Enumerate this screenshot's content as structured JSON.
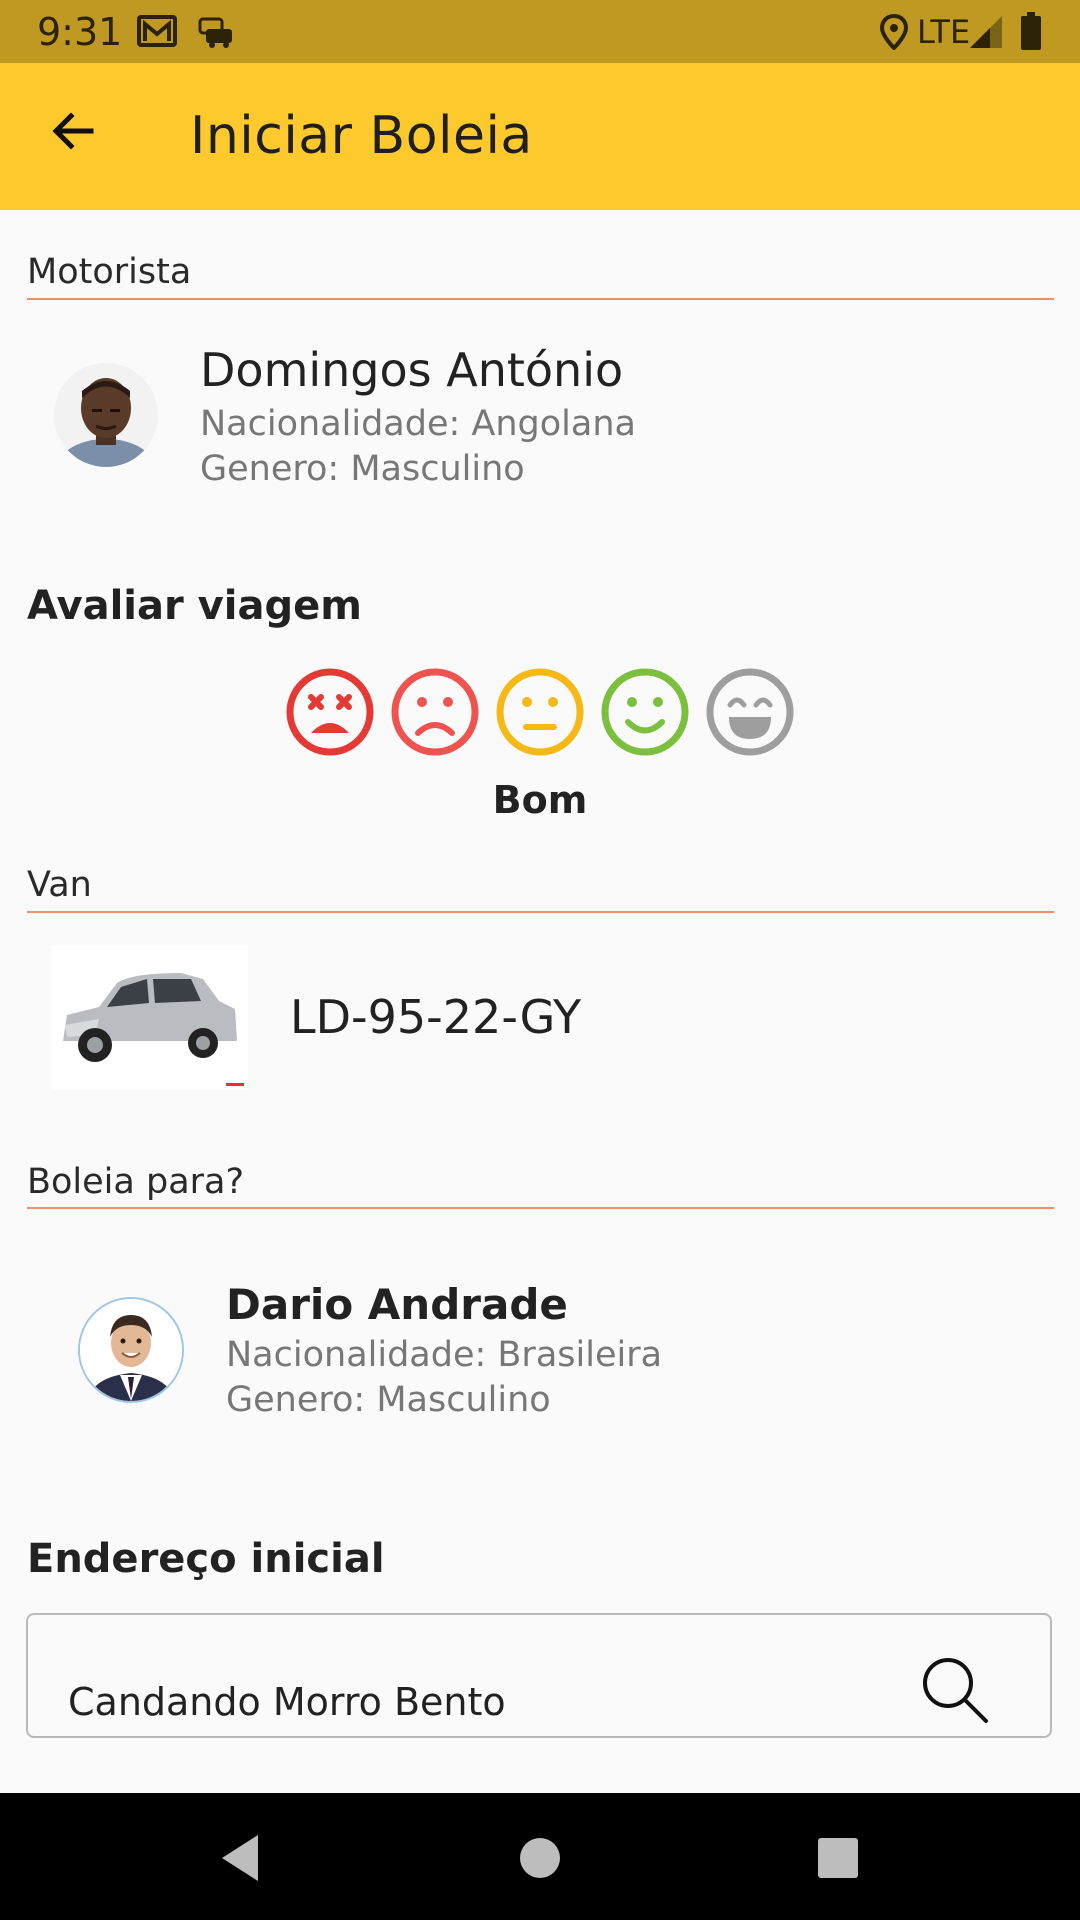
{
  "status_bar": {
    "time": "9:31",
    "network": "LTE",
    "icons": [
      "gmail-icon",
      "car-notification-icon",
      "location-icon",
      "signal-icon",
      "battery-icon"
    ]
  },
  "app_bar": {
    "title": "Iniciar Boleia",
    "back_icon": "arrow-back-icon",
    "background": "#fec92c"
  },
  "driver_section": {
    "label": "Motorista",
    "name": "Domingos António",
    "nationality": "Nacionalidade: Angolana",
    "gender": "Genero: Masculino"
  },
  "rating": {
    "heading": "Avaliar viagem",
    "options": [
      {
        "icon": "dead-face-icon",
        "color": "#e53935"
      },
      {
        "icon": "sad-face-icon",
        "color": "#ef5350"
      },
      {
        "icon": "neutral-face-icon",
        "color": "#f6b814"
      },
      {
        "icon": "smile-face-icon",
        "color": "#7cbf3e"
      },
      {
        "icon": "grin-face-icon",
        "color": "#9e9e9e"
      }
    ],
    "selected_label": "Bom"
  },
  "van_section": {
    "label": "Van",
    "plate": "LD-95-22-GY"
  },
  "passenger_section": {
    "label": "Boleia para?",
    "name": "Dario Andrade",
    "nationality": "Nacionalidade: Brasileira",
    "gender": "Genero: Masculino"
  },
  "address": {
    "heading": "Endereço inicial",
    "value": "Candando Morro Bento"
  },
  "colors": {
    "accent_divider": "#e8906f",
    "status_bar": "#bf9921"
  }
}
